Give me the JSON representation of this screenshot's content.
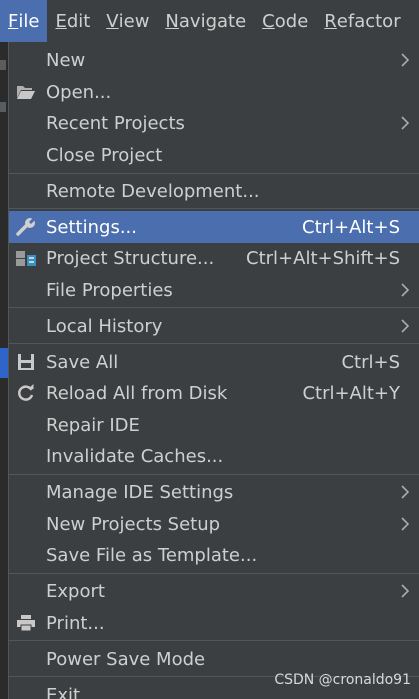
{
  "menubar": {
    "items": [
      {
        "label": "File",
        "mnemonic": "F",
        "rest": "ile"
      },
      {
        "label": "Edit",
        "mnemonic": "E",
        "rest": "dit"
      },
      {
        "label": "View",
        "mnemonic": "V",
        "rest": "iew"
      },
      {
        "label": "Navigate",
        "mnemonic": "N",
        "rest": "avigate"
      },
      {
        "label": "Code",
        "mnemonic": "C",
        "rest": "ode"
      },
      {
        "label": "Refactor",
        "mnemonic": "R",
        "rest": "efactor"
      }
    ]
  },
  "menu": {
    "new": "New",
    "open": "Open...",
    "recent_projects": "Recent Projects",
    "close_project": "Close Project",
    "remote_development": "Remote Development...",
    "settings": "Settings...",
    "settings_shortcut": "Ctrl+Alt+S",
    "project_structure": "Project Structure...",
    "project_structure_shortcut": "Ctrl+Alt+Shift+S",
    "file_properties": "File Properties",
    "local_history": "Local History",
    "save_all": "Save All",
    "save_all_shortcut": "Ctrl+S",
    "reload_all": "Reload All from Disk",
    "reload_all_shortcut": "Ctrl+Alt+Y",
    "repair_ide": "Repair IDE",
    "invalidate_caches": "Invalidate Caches...",
    "manage_ide_settings": "Manage IDE Settings",
    "new_projects_setup": "New Projects Setup",
    "save_file_as_template": "Save File as Template...",
    "export": "Export",
    "print": "Print...",
    "power_save_mode": "Power Save Mode",
    "exit": "Exit"
  },
  "watermark": "CSDN @cronaldo91",
  "colors": {
    "background": "#3c3f41",
    "selection": "#4b6eaf",
    "text": "#cfcfcf"
  }
}
